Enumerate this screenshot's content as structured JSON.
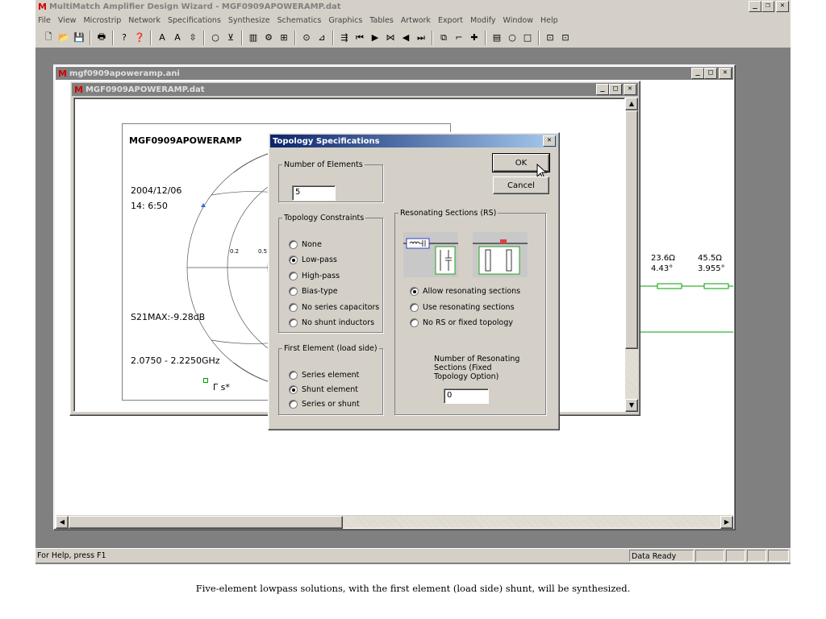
{
  "app": {
    "title": "MultiMatch Amplifier Design Wizard - MGF0909APOWERAMP.dat",
    "menu": [
      "File",
      "View",
      "Microstrip",
      "Network",
      "Specifications",
      "Synthesize",
      "Schematics",
      "Graphics",
      "Tables",
      "Artwork",
      "Export",
      "Modify",
      "Window",
      "Help"
    ],
    "toolbar_icons": [
      "new-icon",
      "open-icon",
      "save-icon",
      "print-icon",
      "help-icon",
      "context-help-icon",
      "text-a-icon",
      "text-a2-icon",
      "cursor-icon",
      "circle-icon",
      "tool-icon",
      "square-icon",
      "network-icon",
      "component-icon",
      "target-icon",
      "tool2-icon",
      "tool3-icon",
      "first-icon",
      "play-icon",
      "step-icon",
      "back-icon",
      "last-icon",
      "window-icon",
      "corner-icon",
      "cross-icon",
      "box-icon",
      "circle2-icon",
      "square2-icon",
      "stack-icon",
      "stack2-icon"
    ],
    "toolbar_glyphs": [
      "🗋",
      "📂",
      "💾",
      "🖶",
      "?",
      "❓",
      "A",
      "A",
      "⇳",
      "○",
      "⊻",
      "▥",
      "⚙",
      "⊞",
      "⊙",
      "⊿",
      "⇶",
      "⏮",
      "▶",
      "⋈",
      "◀",
      "⏭",
      "⧉",
      "⌐",
      "✚",
      "▤",
      "○",
      "□",
      "⊡",
      "⊡"
    ]
  },
  "mdi": {
    "outer_title": "mgf0909apoweramp.ani",
    "inner_title": "MGF0909APOWERAMP.dat"
  },
  "chart": {
    "title": "MGF0909APOWERAMP",
    "date": "2004/12/06",
    "time": "14: 6:50",
    "s21": "S21MAX:-9.28dB",
    "freq": "2.0750 - 2.2250GHz",
    "legend": "Γ s*",
    "tick1": "0.2",
    "tick2": "0.5"
  },
  "schematic": {
    "r1": "23.6Ω",
    "a1": "4.43°",
    "r2": "45.5Ω",
    "a2": "3.955°"
  },
  "dialog": {
    "title": "Topology Specifications",
    "ok": "OK",
    "cancel": "Cancel",
    "num_elements_label": "Number of Elements",
    "num_elements_value": "5",
    "constraints_label": "Topology Constraints",
    "constraints": [
      {
        "label": "None",
        "checked": false
      },
      {
        "label": "Low-pass",
        "checked": true
      },
      {
        "label": "High-pass",
        "checked": false
      },
      {
        "label": "Bias-type",
        "checked": false
      },
      {
        "label": "No series capacitors",
        "checked": false
      },
      {
        "label": "No shunt inductors",
        "checked": false
      }
    ],
    "first_label": "First Element (load side)",
    "first": [
      {
        "label": "Series element",
        "checked": false
      },
      {
        "label": "Shunt element",
        "checked": true
      },
      {
        "label": "Series or shunt",
        "checked": false
      }
    ],
    "rs_label": "Resonating Sections (RS)",
    "rs": [
      {
        "label": "Allow resonating sections",
        "checked": true
      },
      {
        "label": "Use resonating sections",
        "checked": false
      },
      {
        "label": "No RS or fixed topology",
        "checked": false
      }
    ],
    "rs_count_label_1": "Number of Resonating",
    "rs_count_label_2": "Sections (Fixed",
    "rs_count_label_3": "Topology Option)",
    "rs_count_value": "0"
  },
  "status": {
    "help": "For Help, press F1",
    "ready": "Data Ready"
  },
  "caption": "Five-element lowpass solutions, with the first element (load side) shunt, will be synthesized."
}
